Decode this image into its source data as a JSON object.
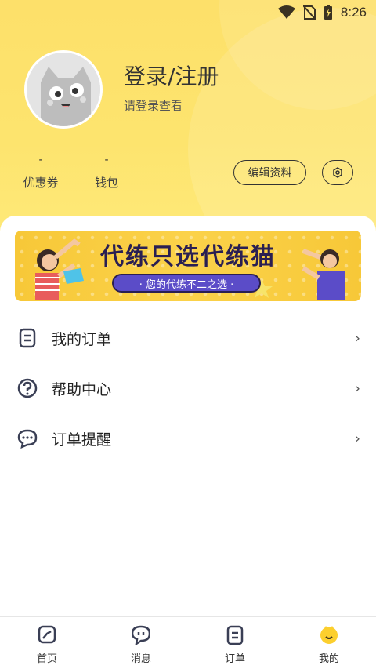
{
  "status_bar": {
    "time": "8:26"
  },
  "profile": {
    "title": "登录/注册",
    "subtitle": "请登录查看"
  },
  "stats": {
    "coupon": {
      "value": "-",
      "label": "优惠券"
    },
    "wallet": {
      "value": "-",
      "label": "钱包"
    }
  },
  "actions": {
    "edit_label": "编辑资料"
  },
  "banner": {
    "title": "代练只选代练猫",
    "slogan": "· 您的代练不二之选 ·"
  },
  "menu": [
    {
      "label": "我的订单",
      "icon": "order-list-icon"
    },
    {
      "label": "帮助中心",
      "icon": "help-icon"
    },
    {
      "label": "订单提醒",
      "icon": "chat-bubble-icon"
    }
  ],
  "bottom_nav": [
    {
      "label": "首页",
      "icon": "home-icon"
    },
    {
      "label": "消息",
      "icon": "message-icon"
    },
    {
      "label": "订单",
      "icon": "order-icon"
    },
    {
      "label": "我的",
      "icon": "profile-icon",
      "active": true
    }
  ],
  "colors": {
    "brand_yellow": "#fde06a",
    "banner_purple": "#5b4cc8",
    "dark_text": "#222222"
  }
}
